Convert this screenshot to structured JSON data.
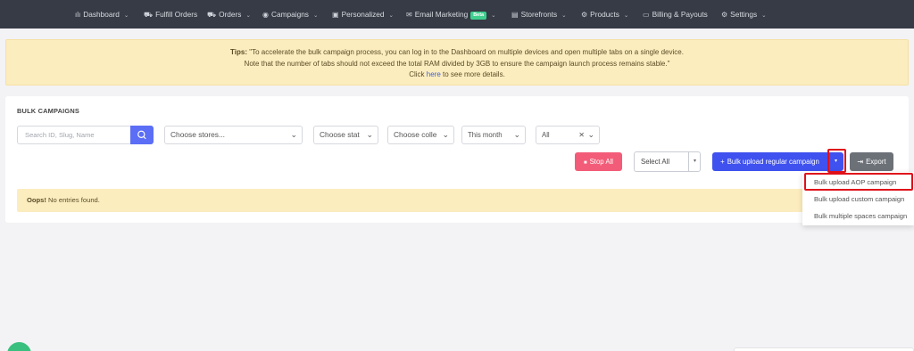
{
  "nav": {
    "items": [
      {
        "icon": "chart-bar-icon",
        "glyph": "ılı",
        "label": "Dashboard",
        "has_chevron": true
      },
      {
        "icon": "cart-icon",
        "glyph": "🛒",
        "label": "Fulfill Orders",
        "has_chevron": false
      },
      {
        "icon": "cart-icon",
        "glyph": "🛒",
        "label": "Orders",
        "has_chevron": true
      },
      {
        "icon": "target-icon",
        "glyph": "◉",
        "label": "Campaigns",
        "has_chevron": true
      },
      {
        "icon": "image-icon",
        "glyph": "▣",
        "label": "Personalized",
        "has_chevron": true
      },
      {
        "icon": "mail-icon",
        "glyph": "✉",
        "label": "Email Marketing",
        "badge": "Beta",
        "has_chevron": true
      },
      {
        "icon": "store-icon",
        "glyph": "▤",
        "label": "Storefronts",
        "has_chevron": true
      },
      {
        "icon": "package-icon",
        "glyph": "⚙",
        "label": "Products",
        "has_chevron": true
      },
      {
        "icon": "card-icon",
        "glyph": "▭",
        "label": "Billing & Payouts",
        "has_chevron": false
      },
      {
        "icon": "gear-icon",
        "glyph": "⚙",
        "label": "Settings",
        "has_chevron": true
      }
    ]
  },
  "tips": {
    "prefix": "Tips:",
    "line1": " \"To accelerate the bulk campaign process, you can log in to the Dashboard on multiple devices and open multiple tabs on a single device.",
    "line2": "Note that the number of tabs should not exceed the total RAM divided by 3GB to ensure the campaign launch process remains stable.\"",
    "line3_pre": "Click ",
    "line3_link": "here",
    "line3_post": " to see more details."
  },
  "bulk": {
    "title": "BULK CAMPAIGNS",
    "search_placeholder": "Search ID, Slug, Name",
    "filters": {
      "stores": "Choose stores...",
      "status": "Choose stat",
      "collection": "Choose colle",
      "period": "This month",
      "type": "All"
    },
    "stop_all": "Stop All",
    "select_all": "Select All",
    "upload_regular": "Bulk upload regular campaign",
    "export": "Export",
    "empty_bold": "Oops!",
    "empty_text": " No entries found."
  },
  "dropdown": {
    "items": [
      "Bulk upload AOP campaign",
      "Bulk upload custom campaign",
      "Bulk multiple spaces campaign"
    ]
  },
  "colors": {
    "nav_bg": "#363b45",
    "primary": "#3f51ee",
    "danger": "#f35c78",
    "warning_bg": "#fcedbf",
    "highlight": "#e0101a"
  }
}
